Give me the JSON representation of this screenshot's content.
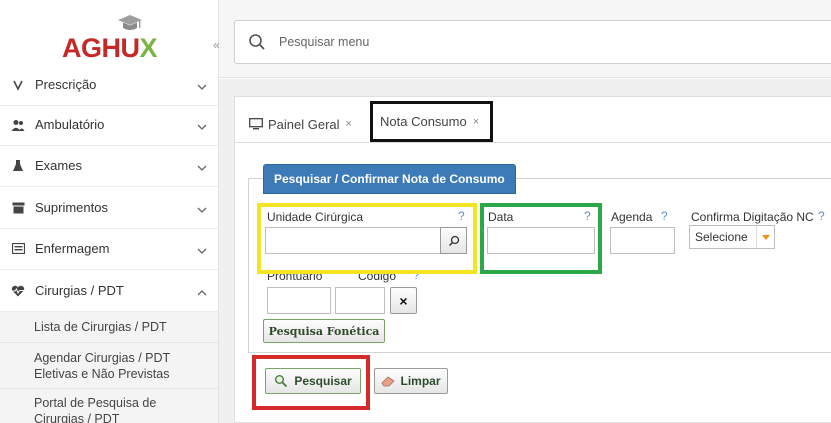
{
  "app": {
    "logo_main": "AGHU",
    "logo_accent": "X"
  },
  "sidebar": {
    "collapse_symbol": "«",
    "items": [
      {
        "label": "Prescrição"
      },
      {
        "label": "Ambulatório"
      },
      {
        "label": "Exames"
      },
      {
        "label": "Suprimentos"
      },
      {
        "label": "Enfermagem"
      },
      {
        "label": "Cirurgias / PDT"
      }
    ],
    "subitems": [
      {
        "label": "Lista de Cirurgias / PDT"
      },
      {
        "label": "Agendar Cirurgias / PDT Eletivas e Não Previstas"
      },
      {
        "label": "Portal de Pesquisa de Cirurgias / PDT"
      }
    ]
  },
  "search": {
    "placeholder": "Pesquisar menu"
  },
  "tabs": [
    {
      "label": "Painel Geral",
      "close": "×"
    },
    {
      "label": "Nota Consumo",
      "close": "×"
    }
  ],
  "form": {
    "legend": "Pesquisar / Confirmar Nota de Consumo",
    "unidade_label": "Unidade Cirúrgica",
    "data_label": "Data",
    "agenda_label": "Agenda",
    "confirma_label": "Confirma Digitação NC",
    "help_mark": "?",
    "select_value": "Selecione",
    "prontuario_label": "Prontuário",
    "codigo_label": "Código",
    "clear_symbol": "×",
    "fonetica_label": "Pesquisa Fonética",
    "pesquisar_label": "Pesquisar",
    "limpar_label": "Limpar"
  },
  "colors": {
    "accent_blue": "#3d7ab8",
    "highlight_yellow": "#f2e622",
    "highlight_green": "#2aa84a",
    "highlight_red": "#d62a2a",
    "highlight_black": "#111111"
  }
}
